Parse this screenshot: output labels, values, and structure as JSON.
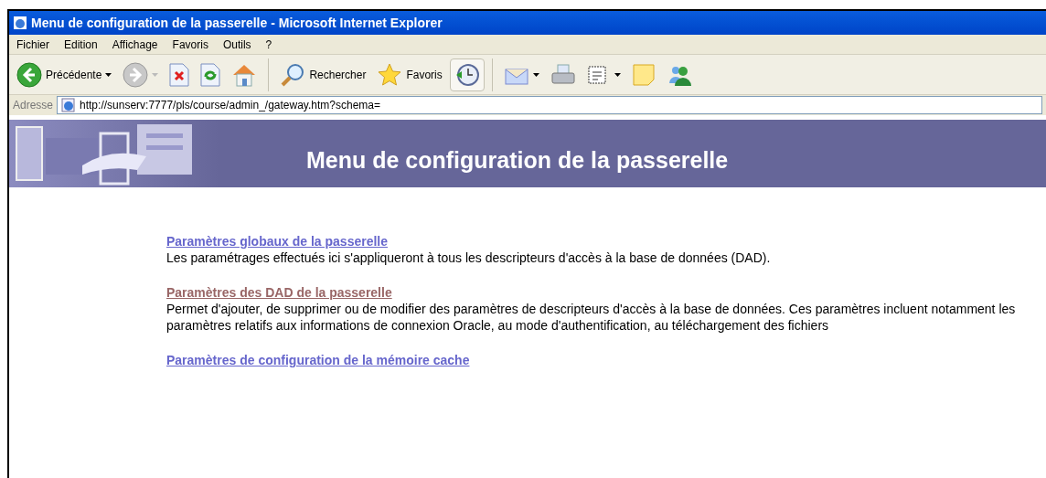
{
  "window": {
    "title": "Menu de configuration de la passerelle - Microsoft Internet Explorer"
  },
  "menu_bar": [
    "Fichier",
    "Edition",
    "Affichage",
    "Favoris",
    "Outils",
    "?"
  ],
  "toolbar": [
    {
      "kind": "back",
      "label": "Précédente",
      "disabled": false
    },
    {
      "kind": "forward",
      "disabled": true
    },
    {
      "kind": "stop"
    },
    {
      "kind": "refresh"
    },
    {
      "kind": "home"
    },
    {
      "kind": "separator"
    },
    {
      "kind": "search",
      "label": "Rechercher"
    },
    {
      "kind": "favorites",
      "label": "Favoris"
    },
    {
      "kind": "history",
      "selected": true
    },
    {
      "kind": "separator"
    },
    {
      "kind": "mail"
    },
    {
      "kind": "print"
    },
    {
      "kind": "edit"
    },
    {
      "kind": "note"
    },
    {
      "kind": "messenger"
    }
  ],
  "address_bar": {
    "label": "Adresse",
    "value": "http://sunserv:7777/pls/course/admin_/gateway.htm?schema="
  },
  "banner": {
    "title": "Menu de configuration de la passerelle"
  },
  "sections": [
    {
      "link": "Paramètres globaux de la passerelle",
      "visited": false,
      "description": "Les paramétrages effectués ici s'appliqueront à tous les descripteurs d'accès à la base de données (DAD)."
    },
    {
      "link": "Paramètres des DAD de la passerelle",
      "visited": true,
      "description": "Permet d'ajouter, de supprimer ou de modifier des paramètres de descripteurs d'accès à la base de données. Ces paramètres incluent notamment les paramètres relatifs aux informations de connexion Oracle, au mode d'authentification, au téléchargement des fichiers"
    },
    {
      "link": "Paramètres de configuration de la mémoire cache",
      "visited": false
    }
  ]
}
